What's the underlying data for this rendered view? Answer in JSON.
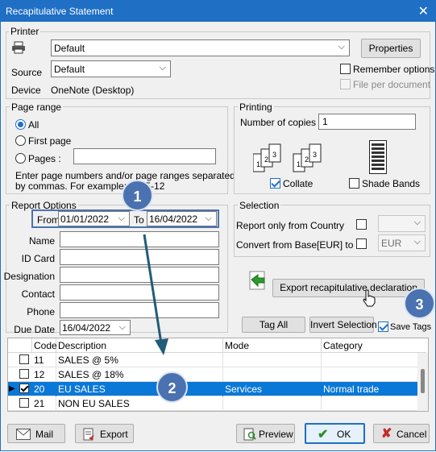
{
  "window": {
    "title": "Recapitulative Statement",
    "close_glyph": "✕"
  },
  "printer": {
    "group_label": "Printer",
    "printer_value": "Default",
    "properties_label": "Properties",
    "source_label": "Source",
    "source_value": "Default",
    "device_label": "Device",
    "device_value": "OneNote (Desktop)",
    "remember_options": "Remember options",
    "file_per_document": "File per document"
  },
  "page_range": {
    "group_label": "Page range",
    "all": "All",
    "first_page": "First page",
    "pages": "Pages :",
    "pages_value": "",
    "hint_line1": "Enter page numbers and/or page ranges separated",
    "hint_line2": "by commas. For example: 1,3,5-12"
  },
  "printing": {
    "group_label": "Printing",
    "copies_label": "Number of copies",
    "copies_value": "1",
    "collate": "Collate",
    "shade_bands": "Shade Bands"
  },
  "report_options": {
    "group_label": "Report Options",
    "from_label": "From",
    "from_value": "01/01/2022",
    "to_label": "To",
    "to_value": "16/04/2022",
    "fields": [
      {
        "label": "Name",
        "value": ""
      },
      {
        "label": "ID Card",
        "value": ""
      },
      {
        "label": "Designation",
        "value": ""
      },
      {
        "label": "Contact",
        "value": ""
      },
      {
        "label": "Phone",
        "value": ""
      }
    ],
    "due_date_label": "Due Date",
    "due_date_value": "16/04/2022"
  },
  "selection": {
    "group_label": "Selection",
    "country_label": "Report only from Country",
    "convert_label": "Convert from Base[EUR] to",
    "currency_value": "EUR"
  },
  "actions": {
    "export_declaration": "Export recapitulative declaration",
    "tag_all": "Tag All",
    "invert_selection": "Invert Selection",
    "save_tags": "Save Tags"
  },
  "badges": [
    "1",
    "2",
    "3"
  ],
  "table": {
    "headers": [
      "Code",
      "Description",
      "Mode",
      "Category"
    ],
    "rows": [
      {
        "code": "11",
        "description": "SALES @ 5%",
        "mode": "",
        "category": "",
        "checked": false,
        "selected": false
      },
      {
        "code": "12",
        "description": "SALES @ 18%",
        "mode": "",
        "category": "",
        "checked": false,
        "selected": false
      },
      {
        "code": "20",
        "description": "EU SALES",
        "mode": "Services",
        "category": "Normal trade",
        "checked": true,
        "selected": true
      },
      {
        "code": "21",
        "description": "NON EU SALES",
        "mode": "",
        "category": "",
        "checked": false,
        "selected": false
      }
    ]
  },
  "footer": {
    "mail": "Mail",
    "export": "Export",
    "preview": "Preview",
    "ok": "OK",
    "cancel": "Cancel"
  },
  "colors": {
    "accent": "#1f6fc5",
    "selection": "#0a78d7",
    "badge": "#4a72b0",
    "ok_green": "#2e8b2e",
    "cancel_red": "#c62828"
  }
}
